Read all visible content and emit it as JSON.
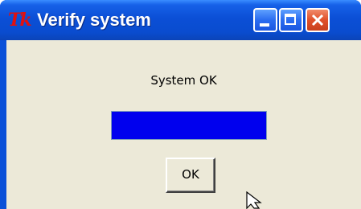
{
  "window": {
    "title": "Verify system",
    "app_icon_text": "Tk",
    "app_icon": "tk-icon"
  },
  "titlebar_buttons": {
    "minimize": "minimize-icon",
    "maximize": "maximize-icon",
    "close": "close-icon"
  },
  "dialog": {
    "message": "System OK",
    "progress": 1.0,
    "ok_label": "OK"
  },
  "colors": {
    "titlebar": "#0a4ccf",
    "client_background": "#ece9d8",
    "progress_fill": "#0000ee",
    "close_button": "#e0502a"
  }
}
